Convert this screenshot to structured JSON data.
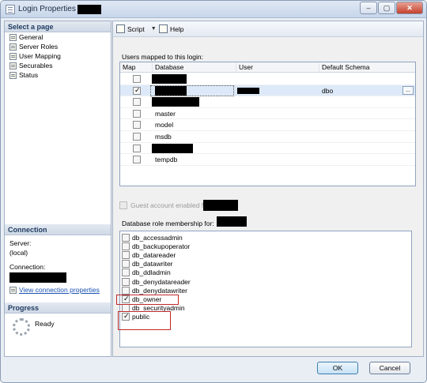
{
  "window": {
    "title": "Login Properties -",
    "buttons": {
      "minimize": "–",
      "maximize": "▢",
      "close": "✕"
    }
  },
  "left": {
    "select_page_header": "Select a page",
    "pages": [
      "General",
      "Server Roles",
      "User Mapping",
      "Securables",
      "Status"
    ],
    "connection_header": "Connection",
    "server_label": "Server:",
    "server_value": "(local)",
    "connection_label": "Connection:",
    "view_connection_link": "View connection properties",
    "progress_header": "Progress",
    "progress_status": "Ready"
  },
  "toolbar": {
    "script_label": "Script",
    "help_label": "Help"
  },
  "mapping": {
    "title": "Users mapped to this login:",
    "columns": [
      "Map",
      "Database",
      "User",
      "Default Schema"
    ],
    "rows": [
      {
        "checked": false,
        "database": "",
        "user": "",
        "schema": "",
        "redacted": true
      },
      {
        "checked": true,
        "database": "",
        "user": "",
        "schema": "dbo",
        "redacted": true,
        "selected": true
      },
      {
        "checked": false,
        "database": "",
        "user": "",
        "schema": "",
        "redacted": true
      },
      {
        "checked": false,
        "database": "master",
        "user": "",
        "schema": ""
      },
      {
        "checked": false,
        "database": "model",
        "user": "",
        "schema": ""
      },
      {
        "checked": false,
        "database": "msdb",
        "user": "",
        "schema": ""
      },
      {
        "checked": false,
        "database": "",
        "user": "",
        "schema": "",
        "redacted": true
      },
      {
        "checked": false,
        "database": "tempdb",
        "user": "",
        "schema": ""
      }
    ]
  },
  "guest": {
    "label": "Guest account enabled for:"
  },
  "roles": {
    "title": "Database role membership for:",
    "items": [
      {
        "name": "db_accessadmin",
        "checked": false
      },
      {
        "name": "db_backupoperator",
        "checked": false
      },
      {
        "name": "db_datareader",
        "checked": false
      },
      {
        "name": "db_datawriter",
        "checked": false
      },
      {
        "name": "db_ddladmin",
        "checked": false
      },
      {
        "name": "db_denydatareader",
        "checked": false
      },
      {
        "name": "db_denydatawriter",
        "checked": false
      },
      {
        "name": "db_owner",
        "checked": true
      },
      {
        "name": "db_securityadmin",
        "checked": false
      },
      {
        "name": "public",
        "checked": true
      }
    ]
  },
  "footer": {
    "ok_label": "OK",
    "cancel_label": "Cancel"
  },
  "colors": {
    "highlight": "#c0282b",
    "link": "#1a53b2"
  }
}
